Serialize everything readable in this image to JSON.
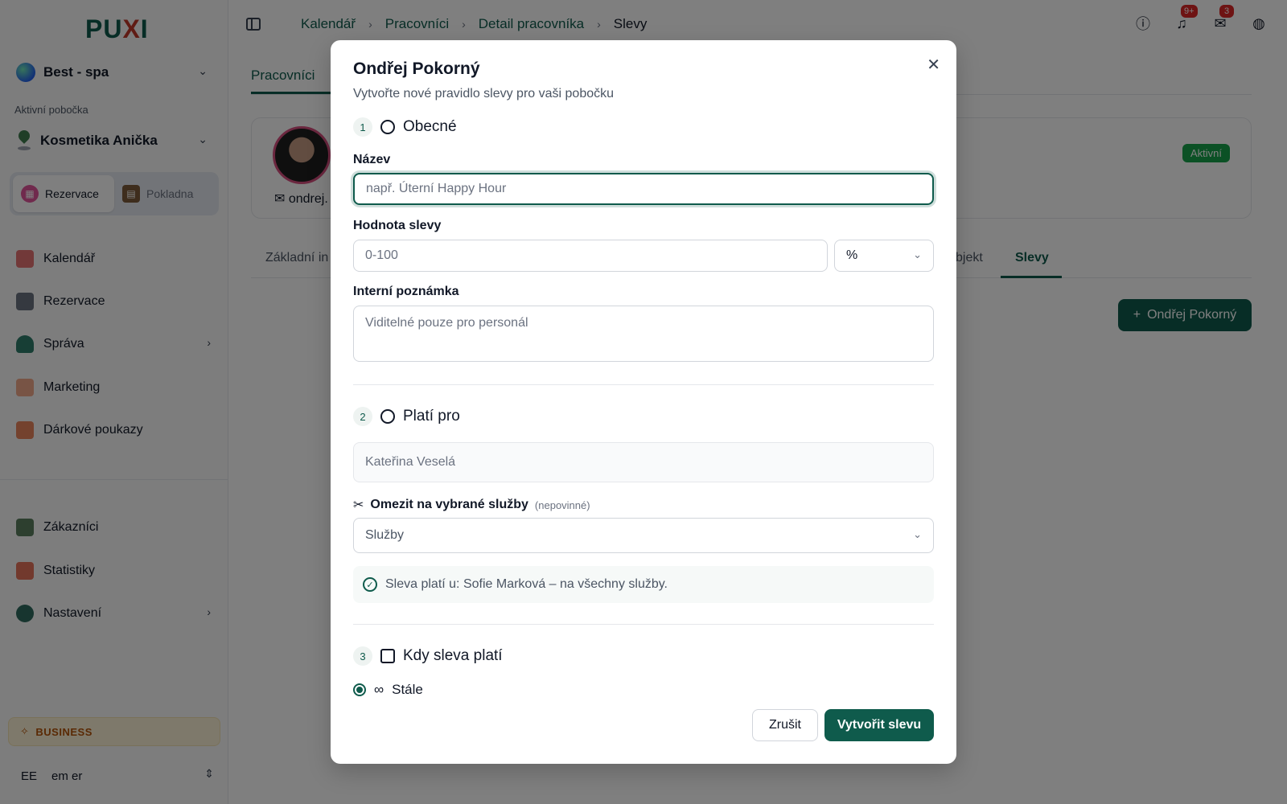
{
  "sidebar": {
    "logo": "PUXI",
    "business_selector": "Best - spa",
    "branch_label": "Aktivní pobočka",
    "branch_selector": "Kosmetika Anička",
    "switch": {
      "reservations": "Rezervace",
      "register": "Pokladna"
    },
    "nav": [
      {
        "label": "Kalendář"
      },
      {
        "label": "Rezervace"
      },
      {
        "label": "Správa"
      },
      {
        "label": "Marketing"
      },
      {
        "label": "Dárkové poukazy"
      },
      {
        "label": "Zákazníci"
      },
      {
        "label": "Statistiky"
      },
      {
        "label": "Nastavení"
      }
    ],
    "plan": "BUSINESS",
    "user": {
      "initials": "EE",
      "name": "em er"
    }
  },
  "header": {
    "breadcrumbs": [
      "Kalendář",
      "Pracovníci",
      "Detail pracovníka"
    ],
    "current": "Slevy",
    "notifications_badge": "9+",
    "messages_badge": "3"
  },
  "page": {
    "top_tab": "Pracovníci",
    "email_partial": "ondrej.",
    "status": "Aktivní",
    "subtab_first": "Základní in",
    "subtab_partial": "bjekt",
    "subtab_active": "Slevy",
    "add_button": "Ondřej Pokorný"
  },
  "modal": {
    "title": "Ondřej Pokorný",
    "subtitle": "Vytvořte nové pravidlo slevy pro vaši pobočku",
    "step1": {
      "num": "1",
      "title": "Obecné"
    },
    "name_label": "Název",
    "name_placeholder": "např. Úterní Happy Hour",
    "value_label": "Hodnota slevy",
    "value_placeholder": "0-100",
    "unit": "%",
    "note_label": "Interní poznámka",
    "note_placeholder": "Viditelné pouze pro personál",
    "step2": {
      "num": "2",
      "title": "Platí pro"
    },
    "worker": "Kateřina Veselá",
    "limit_label": "Omezit na vybrané služby",
    "limit_optional": "(nepovinné)",
    "services_placeholder": "Služby",
    "info": "Sleva platí u: Sofie Marková – na všechny služby.",
    "step3": {
      "num": "3",
      "title": "Kdy sleva platí"
    },
    "always": "Stále",
    "cancel": "Zrušit",
    "create": "Vytvořit slevu"
  },
  "colors": {
    "brand": "#0f5b4c",
    "badge": "#dc2626",
    "status": "#16a34a"
  }
}
